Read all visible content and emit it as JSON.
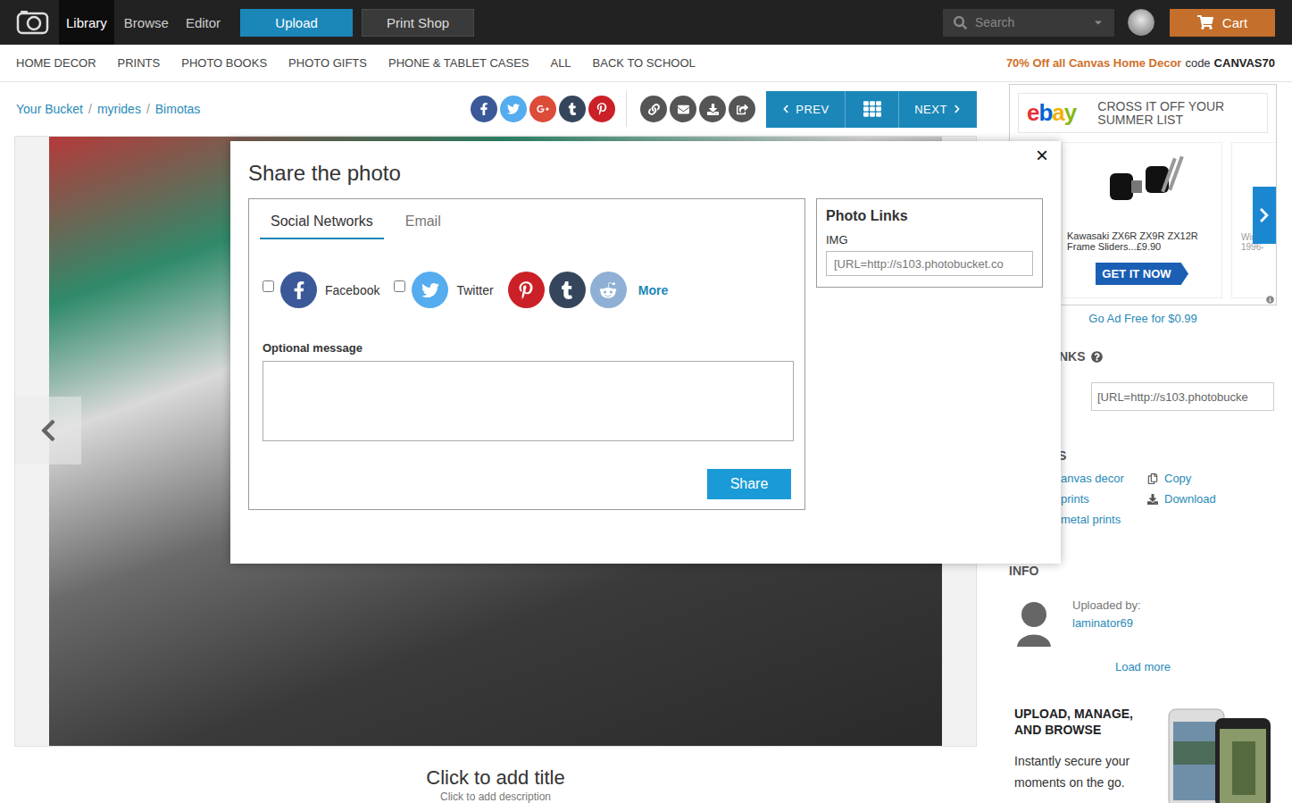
{
  "nav": [
    {
      "label": "Library",
      "selected": true
    },
    {
      "label": "Browse",
      "selected": false
    },
    {
      "label": "Editor",
      "selected": false
    }
  ],
  "upload_button": "Upload",
  "print_shop_button": "Print Shop",
  "search": {
    "placeholder": "Search"
  },
  "cart_button": "Cart",
  "categories": [
    "HOME DECOR",
    "PRINTS",
    "PHOTO BOOKS",
    "PHOTO GIFTS",
    "PHONE & TABLET CASES",
    "ALL",
    "BACK TO SCHOOL"
  ],
  "promo": {
    "offer": "70% Off all Canvas Home Decor",
    "code_label": "code",
    "code": "CANVAS70"
  },
  "breadcrumb": [
    "Your Bucket",
    "myrides",
    "Bimotas"
  ],
  "breadcrumb_separator": "/",
  "share_buttons": [
    {
      "color": "#3b5998"
    },
    {
      "color": "#55acee"
    },
    {
      "color": "#dd4b39"
    },
    {
      "color": "#35465c"
    },
    {
      "color": "#cb2027"
    }
  ],
  "pager": {
    "prev": "PREV",
    "next": "NEXT"
  },
  "photo": {
    "title": "Click to add title",
    "description": "Click to add description"
  },
  "ad": {
    "logo": "ebay",
    "headline": "CROSS IT OFF YOUR SUMMER LIST",
    "product": {
      "title": "Kawasaki ZX6R ZX9R ZX12R Frame Sliders...",
      "price": "£9.90",
      "button": "GET IT NOW"
    },
    "next_product_fragments": [
      "Winn",
      "1996-"
    ]
  },
  "ad_free": "Go Ad Free for $0.99",
  "links_section": {
    "heading": "NKS",
    "value": "[URL=http://s103.photobucke"
  },
  "actions_section": {
    "heading": "S",
    "products": [
      "anvas decor",
      "prints",
      "metal prints"
    ],
    "tools": [
      {
        "label": "Copy"
      },
      {
        "label": "Download"
      }
    ]
  },
  "info": {
    "heading": "INFO",
    "uploaded_by_label": "Uploaded by:",
    "user": "laminator69",
    "load_more": "Load more"
  },
  "app_promo": {
    "title": "UPLOAD, MANAGE, AND BROWSE",
    "text": "Instantly secure your moments on the go."
  },
  "dialog": {
    "title": "Share the photo",
    "close": "×",
    "tabs": [
      {
        "label": "Social Networks",
        "selected": true
      },
      {
        "label": "Email",
        "selected": false
      }
    ],
    "networks": [
      {
        "label": "Facebook",
        "kind": "labeled",
        "checked": false,
        "color": "#3b5998"
      },
      {
        "label": "Twitter",
        "kind": "labeled",
        "checked": false,
        "color": "#55acee"
      },
      {
        "kind": "icon",
        "color": "#cb2027"
      },
      {
        "kind": "icon",
        "color": "#35465c"
      },
      {
        "kind": "icon",
        "color": "#8fb0d4"
      }
    ],
    "more": "More",
    "message_label": "Optional message",
    "share_button": "Share",
    "links_panel": {
      "title": "Photo Links",
      "fields": [
        {
          "label": "IMG",
          "value": "[URL=http://s103.photobucket.co"
        }
      ]
    }
  }
}
